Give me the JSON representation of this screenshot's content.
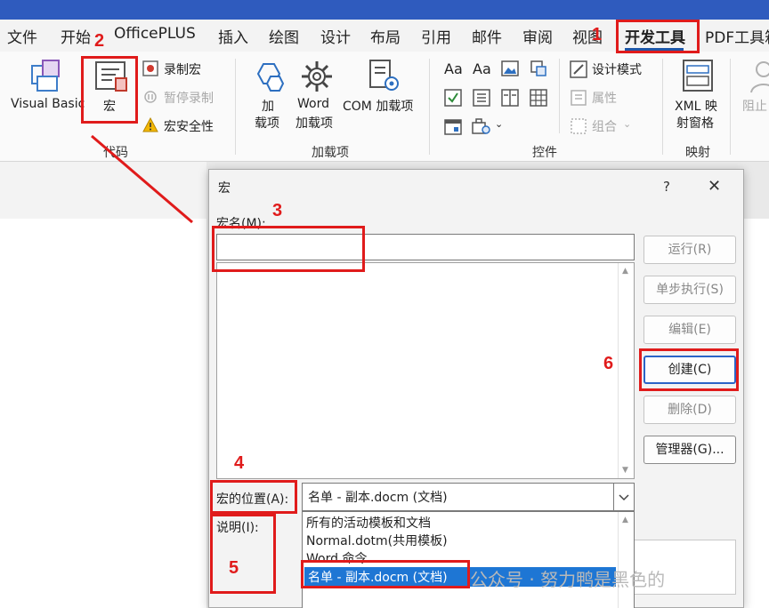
{
  "menu": {
    "items": [
      "文件",
      "开始",
      "OfficePLUS",
      "插入",
      "绘图",
      "设计",
      "布局",
      "引用",
      "邮件",
      "审阅",
      "视图",
      "开发工具",
      "PDF工具箱"
    ],
    "active": "开发工具"
  },
  "ribbon": {
    "code": {
      "visual_basic": "Visual Basic",
      "macros": "宏",
      "record_macro": "录制宏",
      "pause_recording": "暂停录制",
      "macro_security": "宏安全性",
      "group_label": "代码"
    },
    "addins": {
      "add_label_line1": "加",
      "add_label_line2": "载项",
      "word_addins_line1": "Word",
      "word_addins_line2": "加载项",
      "com_addins": "COM 加载项",
      "group_label": "加载项"
    },
    "controls": {
      "design_mode": "设计模式",
      "properties": "属性",
      "group": "组合",
      "group_label": "控件"
    },
    "mapping": {
      "xml_line1": "XML 映",
      "xml_line2": "射窗格",
      "group_label": "映射"
    },
    "protect": {
      "label": "阻止"
    }
  },
  "dialog": {
    "title": "宏",
    "help": "?",
    "close": "✕",
    "macro_name_label": "宏名(M):",
    "macro_name_value": "",
    "buttons": {
      "run": "运行(R)",
      "step_into": "单步执行(S)",
      "edit": "编辑(E)",
      "create": "创建(C)",
      "delete": "删除(D)",
      "organizer": "管理器(G)..."
    },
    "location_label": "宏的位置(A):",
    "location_value": "名单 - 副本.docm (文档)",
    "location_options": [
      "所有的活动模板和文档",
      "Normal.dotm(共用模板)",
      "Word 命令",
      "名单 - 副本.docm (文档)"
    ],
    "description_label": "说明(I):"
  },
  "annotations": [
    "1",
    "2",
    "3",
    "4",
    "5",
    "6"
  ],
  "watermark": "公众号 · 努力鸭是黑色的",
  "colors": {
    "annotation_red": "#e01b1b",
    "title_bar_blue": "#2f5bbe",
    "selection_blue": "#1e76d4",
    "active_tab_underline": "#1f57a8"
  }
}
